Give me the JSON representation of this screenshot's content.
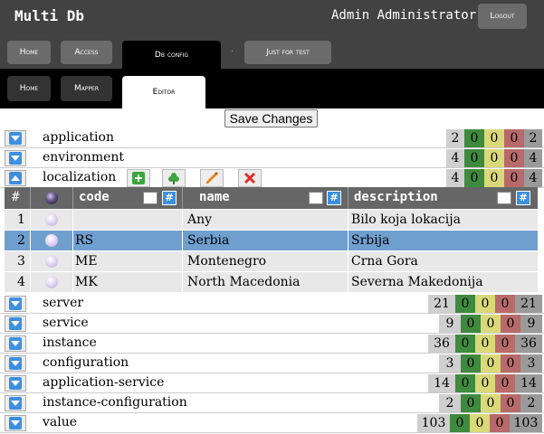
{
  "header": {
    "app_title": "Multi Db",
    "user_name": "Admin Administrator",
    "logout_label": "Logout"
  },
  "main_tabs": [
    {
      "label": "Home"
    },
    {
      "label": "Access"
    },
    {
      "label": "Db config"
    },
    {
      "label": "·"
    },
    {
      "label": "Just for test"
    }
  ],
  "sub_tabs": [
    {
      "label": "Home"
    },
    {
      "label": "Mapper"
    },
    {
      "label": "Editor"
    }
  ],
  "save_label": "Save Changes",
  "entities": [
    {
      "name": "application",
      "counts": [
        "2",
        "0",
        "0",
        "0",
        "2"
      ]
    },
    {
      "name": "environment",
      "counts": [
        "4",
        "0",
        "0",
        "0",
        "4"
      ]
    },
    {
      "name": "localization",
      "counts": [
        "4",
        "0",
        "0",
        "0",
        "4"
      ]
    },
    {
      "name": "server",
      "counts": [
        "21",
        "0",
        "0",
        "0",
        "21"
      ]
    },
    {
      "name": "service",
      "counts": [
        "9",
        "0",
        "0",
        "0",
        "9"
      ]
    },
    {
      "name": "instance",
      "counts": [
        "36",
        "0",
        "0",
        "0",
        "36"
      ]
    },
    {
      "name": "configuration",
      "counts": [
        "3",
        "0",
        "0",
        "0",
        "3"
      ]
    },
    {
      "name": "application-service",
      "counts": [
        "14",
        "0",
        "0",
        "0",
        "14"
      ]
    },
    {
      "name": "instance-configuration",
      "counts": [
        "2",
        "0",
        "0",
        "0",
        "2"
      ]
    },
    {
      "name": "value",
      "counts": [
        "103",
        "0",
        "0",
        "0",
        "103"
      ]
    }
  ],
  "grid": {
    "columns": [
      "#",
      "code",
      "name",
      "description"
    ],
    "filter_icon": "#",
    "rows": [
      {
        "num": "1",
        "code": "",
        "name": "Any",
        "description": "Bilo koja lokacija"
      },
      {
        "num": "2",
        "code": "RS",
        "name": "Serbia",
        "description": "Srbija"
      },
      {
        "num": "3",
        "code": "ME",
        "name": "Montenegro",
        "description": "Crna Gora"
      },
      {
        "num": "4",
        "code": "MK",
        "name": "North Macedonia",
        "description": "Severna Makedonija"
      }
    ]
  },
  "colors": {
    "header_bg": "#424242",
    "selected_row": "#6f9fcf",
    "expand_button": "#3d8fe0",
    "count_added": "#3f8a3f",
    "count_modified": "#d9d97a",
    "count_deleted": "#b86a6a"
  }
}
